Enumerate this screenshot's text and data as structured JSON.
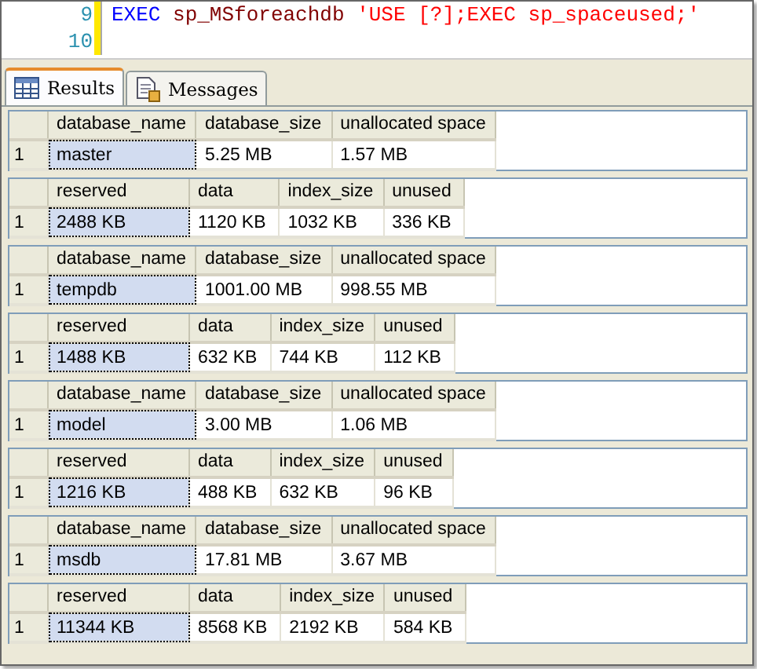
{
  "editor": {
    "lines": [
      {
        "number": "9",
        "tokens": [
          {
            "kind": "keyword",
            "text": "EXEC"
          },
          {
            "kind": "procedure",
            "text": "sp_MSforeachdb"
          },
          {
            "kind": "string",
            "text": "'USE [?];EXEC sp_spaceused;'"
          }
        ]
      },
      {
        "number": "10"
      }
    ]
  },
  "tabs": [
    {
      "label": "Results",
      "kind": "grid",
      "selected": true
    },
    {
      "label": "Messages",
      "kind": "document",
      "selected": false
    }
  ],
  "grids": [
    {
      "columns": [
        "database_name",
        "database_size",
        "unallocated space"
      ],
      "rows": [
        {
          "number": "1",
          "cells": [
            {
              "text": "master",
              "selected": true
            },
            {
              "text": "5.25 MB",
              "selected": false
            },
            {
              "text": "1.57 MB",
              "selected": false
            }
          ]
        }
      ]
    },
    {
      "columns": [
        "reserved",
        "data",
        "index_size",
        "unused"
      ],
      "rows": [
        {
          "number": "1",
          "cells": [
            {
              "text": "2488 KB",
              "selected": true
            },
            {
              "text": "1120 KB",
              "selected": false
            },
            {
              "text": "1032 KB",
              "selected": false
            },
            {
              "text": "336 KB",
              "selected": false
            }
          ]
        }
      ]
    },
    {
      "columns": [
        "database_name",
        "database_size",
        "unallocated space"
      ],
      "rows": [
        {
          "number": "1",
          "cells": [
            {
              "text": "tempdb",
              "selected": true
            },
            {
              "text": "1001.00 MB",
              "selected": false
            },
            {
              "text": "998.55 MB",
              "selected": false
            }
          ]
        }
      ]
    },
    {
      "columns": [
        "reserved",
        "data",
        "index_size",
        "unused"
      ],
      "rows": [
        {
          "number": "1",
          "cells": [
            {
              "text": "1488 KB",
              "selected": true
            },
            {
              "text": "632 KB",
              "selected": false
            },
            {
              "text": "744 KB",
              "selected": false
            },
            {
              "text": "112 KB",
              "selected": false
            }
          ]
        }
      ]
    },
    {
      "columns": [
        "database_name",
        "database_size",
        "unallocated space"
      ],
      "rows": [
        {
          "number": "1",
          "cells": [
            {
              "text": "model",
              "selected": true
            },
            {
              "text": "3.00 MB",
              "selected": false
            },
            {
              "text": "1.06 MB",
              "selected": false
            }
          ]
        }
      ]
    },
    {
      "columns": [
        "reserved",
        "data",
        "index_size",
        "unused"
      ],
      "rows": [
        {
          "number": "1",
          "cells": [
            {
              "text": "1216 KB",
              "selected": true
            },
            {
              "text": "488 KB",
              "selected": false
            },
            {
              "text": "632 KB",
              "selected": false
            },
            {
              "text": "96 KB",
              "selected": false
            }
          ]
        }
      ]
    },
    {
      "columns": [
        "database_name",
        "database_size",
        "unallocated space"
      ],
      "rows": [
        {
          "number": "1",
          "cells": [
            {
              "text": "msdb",
              "selected": true
            },
            {
              "text": "17.81 MB",
              "selected": false
            },
            {
              "text": "3.67 MB",
              "selected": false
            }
          ]
        }
      ]
    },
    {
      "columns": [
        "reserved",
        "data",
        "index_size",
        "unused"
      ],
      "rows": [
        {
          "number": "1",
          "cells": [
            {
              "text": "11344 KB",
              "selected": true
            },
            {
              "text": "8568 KB",
              "selected": false
            },
            {
              "text": "2192 KB",
              "selected": false
            },
            {
              "text": "584 KB",
              "selected": false
            }
          ]
        }
      ]
    }
  ]
}
